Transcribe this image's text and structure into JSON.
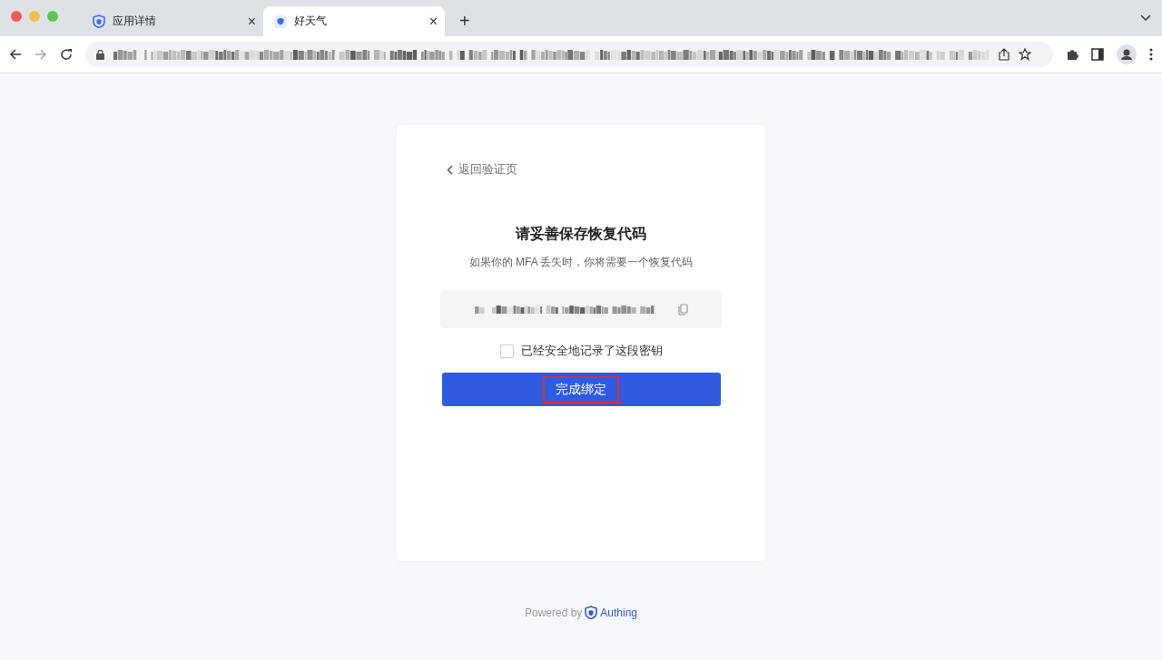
{
  "browser": {
    "tabs": [
      {
        "title": "应用详情",
        "selected": false,
        "close": "×"
      },
      {
        "title": "好天气",
        "selected": true,
        "close": "×"
      }
    ],
    "new_tab": "+"
  },
  "card": {
    "back_link": "返回验证页",
    "title": "请妥善保存恢复代码",
    "subtitle": "如果你的 MFA 丢失时，你将需要一个恢复代码",
    "checkbox": {
      "label": "已经安全地记录了这段密钥",
      "checked": false
    },
    "button": {
      "label": "完成绑定",
      "highlighted": true
    }
  },
  "footer": {
    "prefix": "Powered by",
    "brand": "Authing"
  }
}
